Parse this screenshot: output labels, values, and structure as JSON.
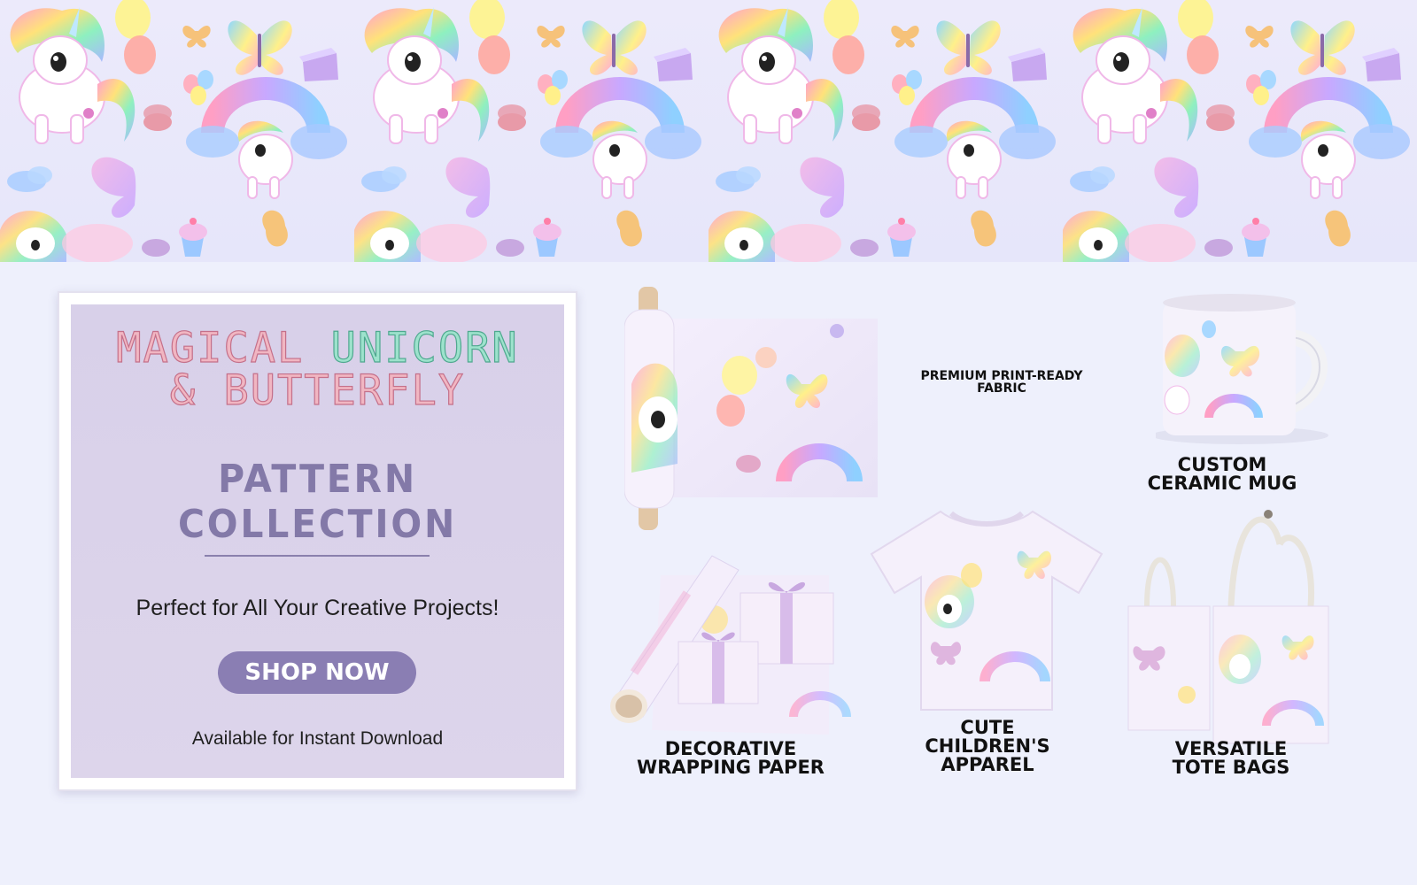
{
  "banner": {
    "label": "Repeating unicorn and butterfly pattern"
  },
  "card": {
    "title_line1_part1": "MAGICAL",
    "title_line1_part2": "UNICORN",
    "title_line2": "& BUTTERFLY",
    "subtitle": "PATTERN COLLECTION",
    "tagline": "Perfect for All Your Creative Projects!",
    "button_label": "SHOP NOW",
    "footnote": "Available for Instant Download"
  },
  "products": {
    "fabric": {
      "line1": "PREMIUM PRINT-READY",
      "line2": "FABRIC"
    },
    "mug": {
      "line1": "CUSTOM",
      "line2": "CERAMIC MUG"
    },
    "wrapping": {
      "line1": "DECORATIVE",
      "line2": "WRAPPING PAPER"
    },
    "apparel": {
      "line1": "CUTE",
      "line2": "CHILDREN'S",
      "line3": "APPAREL"
    },
    "tote": {
      "line1": "VERSATILE",
      "line2": "TOTE BAGS"
    }
  },
  "colors": {
    "page_bg": "#eef0fc",
    "card_bg": "#d8d0e9",
    "accent_purple": "#8a7eb3",
    "title_pink": "#f1b6c2",
    "title_mint": "#9de2cc"
  },
  "icons": [
    "unicorn-icon",
    "butterfly-icon",
    "rainbow-icon",
    "balloon-icon",
    "macaron-icon",
    "cupcake-icon",
    "cake-icon",
    "cloud-icon"
  ]
}
